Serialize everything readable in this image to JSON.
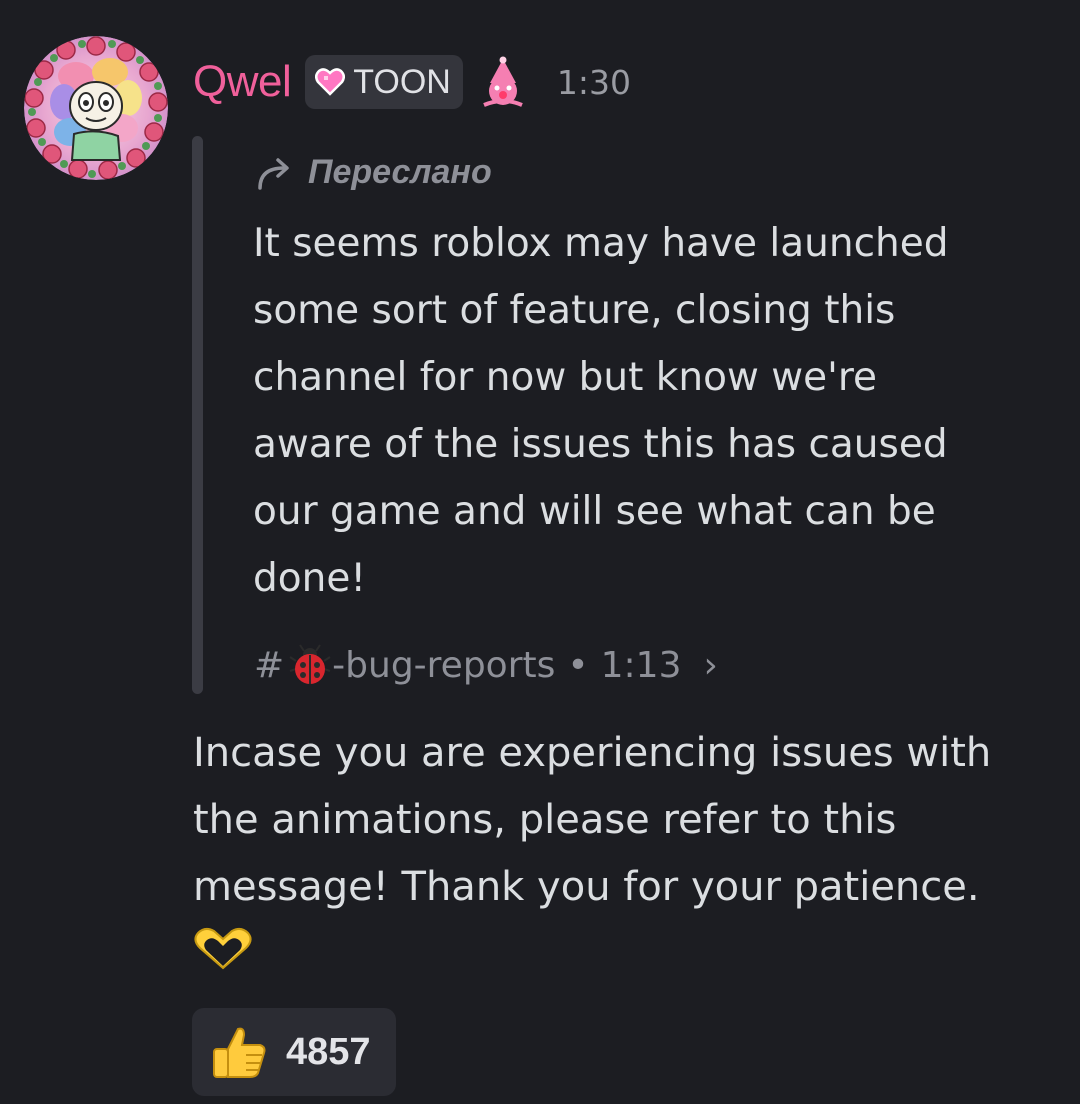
{
  "message": {
    "author": {
      "username": "Qwel",
      "tag_label": "TOON",
      "tag_icon": "pink-heart-icon",
      "role_icon": "pink-clown-icon",
      "avatar": "flower-character-avatar"
    },
    "timestamp": "1:30",
    "forwarded": {
      "label": "Переслано",
      "lines": [
        "It seems roblox may have launched",
        "some sort of feature, closing this",
        "channel for now but know we're",
        "aware of the issues this has caused",
        "our game and will see what can be",
        "done!"
      ],
      "source": {
        "hash": "#",
        "channel_emoji": "ladybug-icon",
        "channel_name": "-bug-reports",
        "separator": "•",
        "time": "1:13",
        "chevron": "›"
      }
    },
    "body_lines": [
      "Incase you are experiencing issues with",
      "the animations, please refer to this",
      "message! Thank you for your patience."
    ],
    "trailing_emoji": "heart-hands-icon",
    "reactions": [
      {
        "emoji": "thumbs-up-icon",
        "count": "4857"
      }
    ]
  },
  "colors": {
    "background": "#1c1d22",
    "username": "#f0609b",
    "text": "#dbdee1",
    "muted": "#8e9098",
    "tag_bg": "#34353c",
    "reaction_bg": "#2b2c33"
  }
}
